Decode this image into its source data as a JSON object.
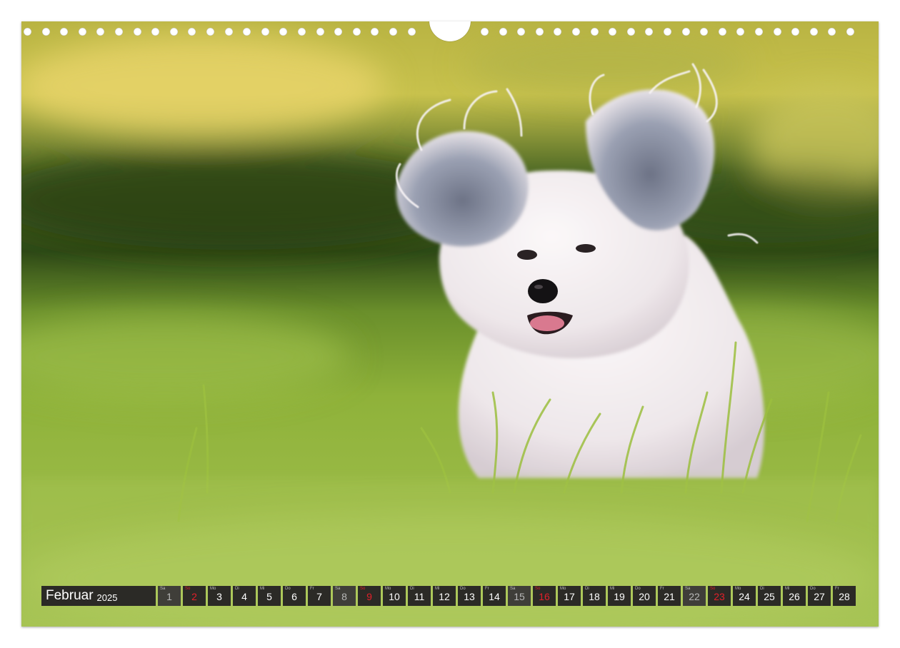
{
  "calendar": {
    "month": "Februar",
    "year": "2025",
    "days": [
      {
        "wd": "Sa",
        "n": "1",
        "type": "sat"
      },
      {
        "wd": "So",
        "n": "2",
        "type": "sun"
      },
      {
        "wd": "Mo",
        "n": "3",
        "type": "work"
      },
      {
        "wd": "Di",
        "n": "4",
        "type": "work"
      },
      {
        "wd": "Mi",
        "n": "5",
        "type": "work"
      },
      {
        "wd": "Do",
        "n": "6",
        "type": "work"
      },
      {
        "wd": "Fr",
        "n": "7",
        "type": "work"
      },
      {
        "wd": "Sa",
        "n": "8",
        "type": "sat"
      },
      {
        "wd": "So",
        "n": "9",
        "type": "sun"
      },
      {
        "wd": "Mo",
        "n": "10",
        "type": "work"
      },
      {
        "wd": "Di",
        "n": "11",
        "type": "work"
      },
      {
        "wd": "Mi",
        "n": "12",
        "type": "work"
      },
      {
        "wd": "Do",
        "n": "13",
        "type": "work"
      },
      {
        "wd": "Fr",
        "n": "14",
        "type": "work"
      },
      {
        "wd": "Sa",
        "n": "15",
        "type": "sat"
      },
      {
        "wd": "So",
        "n": "16",
        "type": "sun"
      },
      {
        "wd": "Mo",
        "n": "17",
        "type": "work"
      },
      {
        "wd": "Di",
        "n": "18",
        "type": "work"
      },
      {
        "wd": "Mi",
        "n": "19",
        "type": "work"
      },
      {
        "wd": "Do",
        "n": "20",
        "type": "work"
      },
      {
        "wd": "Fr",
        "n": "21",
        "type": "work"
      },
      {
        "wd": "Sa",
        "n": "22",
        "type": "sat"
      },
      {
        "wd": "So",
        "n": "23",
        "type": "sun"
      },
      {
        "wd": "Mo",
        "n": "24",
        "type": "work"
      },
      {
        "wd": "Di",
        "n": "25",
        "type": "work"
      },
      {
        "wd": "Mi",
        "n": "26",
        "type": "work"
      },
      {
        "wd": "Do",
        "n": "27",
        "type": "work"
      },
      {
        "wd": "Fr",
        "n": "28",
        "type": "work"
      }
    ]
  },
  "colors": {
    "bar_bg": "#2b2a26",
    "sunday_red": "#e2202a",
    "grass_green": "#8fb23a",
    "dog_white": "#f1ecef"
  }
}
